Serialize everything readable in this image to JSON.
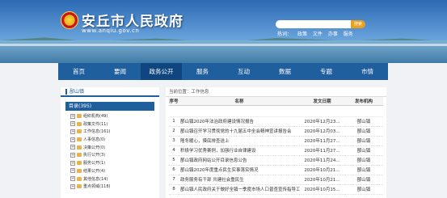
{
  "header": {
    "site_title": "安丘市人民政府",
    "site_url": "www.anqiu.gov.cn",
    "search_button": "搜索",
    "hotwords_label": "热词：",
    "hotwords": [
      "政策",
      "文件",
      "办事",
      "服务"
    ]
  },
  "nav": {
    "items": [
      "首页",
      "要闻",
      "政务公开",
      "服务",
      "互动",
      "数据",
      "专题",
      "市情"
    ],
    "active_index": 2
  },
  "left": {
    "panel_title": "郚山镇",
    "root_label": "目录(395)",
    "tree": [
      "组织机构(49)",
      "政策文件(11)",
      "工作信息(161)",
      "人事信息(0)",
      "决策公开(0)",
      "执行公开(3)",
      "服务公开(1)",
      "结果公开(4)",
      "其他信息(14)",
      "重点领域(118)"
    ]
  },
  "right": {
    "breadcrumb": "当前位置：工作信息",
    "columns": [
      "序号",
      "名称",
      "发文日期",
      "发布机构"
    ],
    "rows": [
      {
        "num": "1",
        "title": "郚山镇2020年法治政府建设情况报告",
        "date": "2020年12月23...",
        "org": "郚山镇"
      },
      {
        "num": "2",
        "title": "郚山镇召开学习贯彻党的十九届五中全会精神宣讲报告会",
        "date": "2020年12月03...",
        "org": "郚山镇"
      },
      {
        "num": "3",
        "title": "隆冬暖心，摸底排查送上",
        "date": "2020年11月27...",
        "org": "郚山镇"
      },
      {
        "num": "4",
        "title": "积极学习优秀案例，加强行业自律建设",
        "date": "2020年11月27...",
        "org": "郚山镇"
      },
      {
        "num": "5",
        "title": "郚山镇政府网站公开目录信息公告",
        "date": "2020年11月24...",
        "org": "郚山镇"
      },
      {
        "num": "6",
        "title": "郚山镇2020年度重点民生实事落实情况",
        "date": "2020年10月21...",
        "org": "郚山镇"
      },
      {
        "num": "7",
        "title": "政务服务有干部 共建社会重民生",
        "date": "2020年10月21...",
        "org": "郚山镇"
      },
      {
        "num": "8",
        "title": "郚山镇人民政府关于做好全镇一季度市场人口普查宣传指导工作的通知",
        "date": "2020年10月15...",
        "org": "郚山镇"
      }
    ]
  }
}
